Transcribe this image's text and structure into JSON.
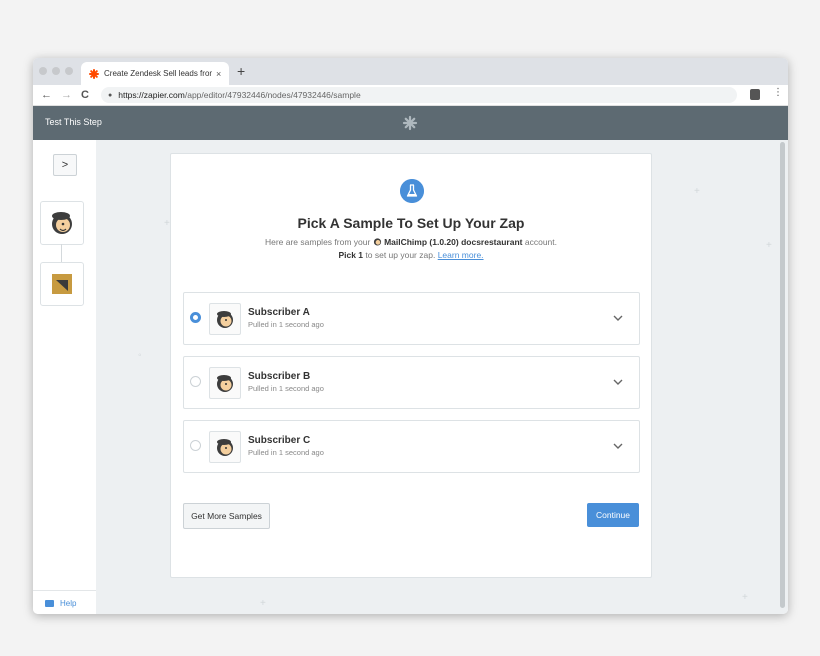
{
  "browser": {
    "tab_title": "Create Zendesk Sell leads from",
    "tab_close": "×",
    "new_tab": "+",
    "back": "←",
    "forward": "→",
    "reload": "C",
    "url_host": "https://zapier.com",
    "url_path": "/app/editor/47932446/nodes/47932446/sample",
    "menu": "⋮"
  },
  "app": {
    "header_title": "Test This Step",
    "help_label": "Help",
    "expand_label": ">"
  },
  "panel": {
    "heading": "Pick A Sample To Set Up Your Zap",
    "intro_prefix": "Here are samples from your",
    "app_name": "MailChimp (1.0.20)",
    "account_name": "docsrestaurant",
    "intro_suffix": "account.",
    "pick_count": "Pick 1",
    "pick_suffix": "to set up your zap.",
    "learn_more": "Learn more."
  },
  "samples": [
    {
      "name": "Subscriber A",
      "time": "Pulled in 1 second ago",
      "selected": true
    },
    {
      "name": "Subscriber B",
      "time": "Pulled in 1 second ago",
      "selected": false
    },
    {
      "name": "Subscriber C",
      "time": "Pulled in 1 second ago",
      "selected": false
    }
  ],
  "buttons": {
    "get_more": "Get More Samples",
    "continue": "Continue"
  },
  "colors": {
    "accent": "#498fd9",
    "header_bg": "#5d6a72",
    "zapier_orange": "#ff4a00"
  },
  "icons": [
    "zapier-logo-icon",
    "mailchimp-icon",
    "zendesk-sell-icon",
    "flask-icon",
    "chevron-down-icon",
    "lock-icon",
    "help-chat-icon"
  ]
}
